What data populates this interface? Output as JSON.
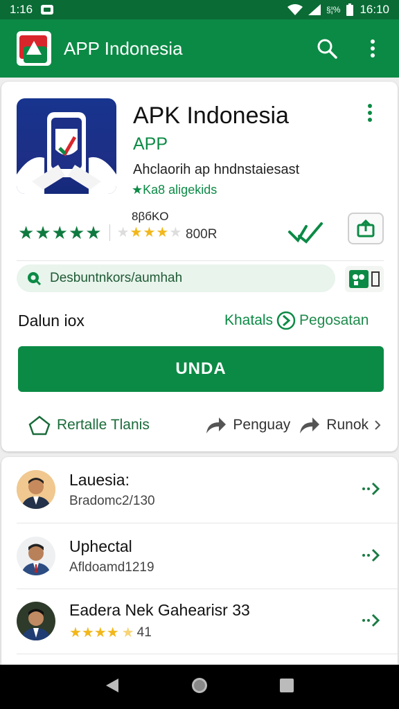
{
  "status_bar": {
    "time_left": "1:16",
    "signal_text": "§¦%",
    "time_right": "16:10"
  },
  "app_bar": {
    "title": "APP Indonesia"
  },
  "app": {
    "name": "APK Indonesia",
    "developer": "APP",
    "description": "Ahclaorih ap hndnstaiesast",
    "tag": "Ka8 aligekids",
    "rating_count_label": "8βбKO",
    "rating_count_value": "800R",
    "search_chip_label": "Desbuntnkors/aumhah",
    "row_label": "Dalun iox",
    "row_right_label": "Khatals",
    "row_right_label2": "Pegosatan",
    "install_label": "UNDA",
    "links": [
      {
        "label": "Rertalle Tlanis"
      },
      {
        "label": "Penguay"
      },
      {
        "label": "Runok"
      }
    ]
  },
  "list": [
    {
      "title": "Lauesia:",
      "subtitle": "Bradomc2/130"
    },
    {
      "title": "Uphectal",
      "subtitle": "Afldoamd1219"
    },
    {
      "title": "Eadera Nek Gahearisr 33",
      "subtitle": "41",
      "stars": 4.5
    }
  ],
  "colors": {
    "primary": "#0b8a45",
    "status_bar": "#0a6b35",
    "star": "#f2b71b"
  }
}
